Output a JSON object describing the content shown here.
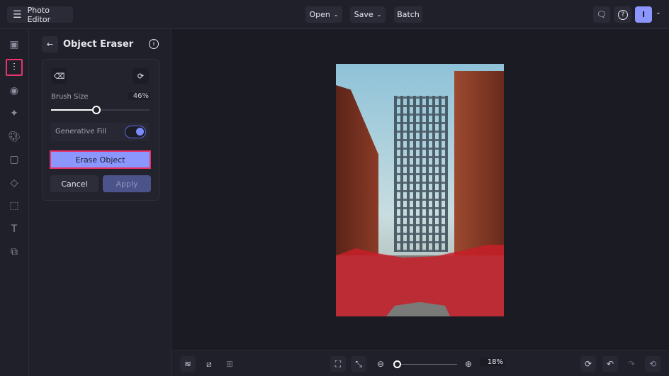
{
  "header": {
    "app_title": "Photo Editor",
    "open_label": "Open",
    "save_label": "Save",
    "batch_label": "Batch",
    "avatar_initial": "I"
  },
  "panel": {
    "title": "Object Eraser",
    "brush_size_label": "Brush Size",
    "brush_size_value": "46%",
    "brush_size_percent": 46,
    "generative_fill_label": "Generative Fill",
    "generative_fill_on": true,
    "erase_label": "Erase Object",
    "cancel_label": "Cancel",
    "apply_label": "Apply"
  },
  "zoom": {
    "value": "18%",
    "percent": 18
  },
  "colors": {
    "accent": "#7b8cff",
    "highlight": "#e8336b",
    "mask": "#c81e28"
  }
}
